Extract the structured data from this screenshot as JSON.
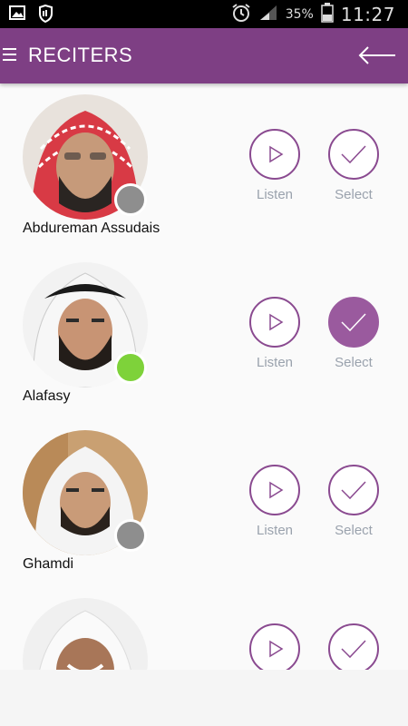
{
  "status_bar": {
    "icons_left": [
      "image-icon",
      "shield-hand-icon"
    ],
    "icons_right": [
      "alarm-icon",
      "signal-icon",
      "battery-icon"
    ],
    "battery": "35%",
    "time": "11:27"
  },
  "app_bar": {
    "title": "RECITERS",
    "color": "#7e3f84"
  },
  "reciters": [
    {
      "name": "Abdureman Assudais",
      "status": "offline",
      "status_color": "#8e8e8e",
      "selected": false,
      "listen_label": "Listen",
      "select_label": "Select"
    },
    {
      "name": "Alafasy",
      "status": "online",
      "status_color": "#7ed23a",
      "selected": true,
      "listen_label": "Listen",
      "select_label": "Select"
    },
    {
      "name": "Ghamdi",
      "status": "offline",
      "status_color": "#8e8e8e",
      "selected": false,
      "listen_label": "Listen",
      "select_label": "Select"
    },
    {
      "name": "",
      "status": "offline",
      "status_color": "#8e8e8e",
      "selected": false,
      "listen_label": "",
      "select_label": ""
    }
  ]
}
